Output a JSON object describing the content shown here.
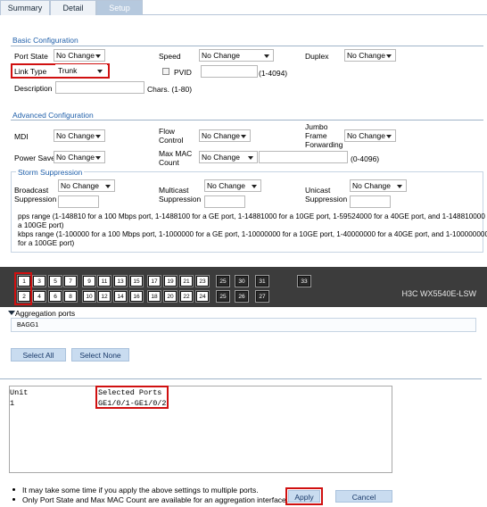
{
  "tabs": [
    "Summary",
    "Detail",
    "Setup"
  ],
  "basic": {
    "title": "Basic Configuration",
    "port_state_label": "Port State",
    "port_state_value": "No Change",
    "speed_label": "Speed",
    "speed_value": "No Change",
    "duplex_label": "Duplex",
    "duplex_value": "No Change",
    "link_type_label": "Link Type",
    "link_type_value": "Trunk",
    "pvid_label": "PVID",
    "pvid_hint": "(1-4094)",
    "description_label": "Description",
    "description_hint": "Chars. (1-80)"
  },
  "advanced": {
    "title": "Advanced Configuration",
    "mdi_label": "MDI",
    "mdi_value": "No Change",
    "flow_label_1": "Flow",
    "flow_label_2": "Control",
    "flow_value": "No Change",
    "jumbo_label_1": "Jumbo",
    "jumbo_label_2": "Frame",
    "jumbo_label_3": "Forwarding",
    "jumbo_value": "No Change",
    "power_label": "Power Save",
    "power_value": "No Change",
    "maxmac_label_1": "Max MAC",
    "maxmac_label_2": "Count",
    "maxmac_value": "No Change",
    "maxmac_hint": "(0-4096)"
  },
  "storm": {
    "title": "Storm Suppression",
    "broadcast_1": "Broadcast",
    "broadcast_2": "Suppression",
    "broadcast_value": "No Change",
    "multicast_1": "Multicast",
    "multicast_2": "Suppression",
    "multicast_value": "No Change",
    "unicast_1": "Unicast",
    "unicast_2": "Suppression",
    "unicast_value": "No Change",
    "pps_1": "pps range (1-148810 for a 100 Mbps port, 1-1488100 for a GE port, 1-14881000 for a 10GE port, 1-59524000 for a 40GE port, and 1-148810000 for",
    "pps_2": "a 100GE port)",
    "kbps_1": "kbps range (1-100000 for a 100 Mbps port, 1-1000000 for a GE port, 1-10000000 for a 10GE port, 1-40000000 for a 40GE port, and 1-100000000",
    "kbps_2": "for a 100GE port)"
  },
  "panel": {
    "device": "H3C WX5540E-LSW",
    "top_ports": [
      "1",
      "3",
      "5",
      "7",
      "9",
      "11",
      "13",
      "15",
      "17",
      "19",
      "21",
      "23",
      "25",
      "30",
      "31",
      "33"
    ],
    "bottom_ports": [
      "2",
      "4",
      "6",
      "8",
      "10",
      "12",
      "14",
      "16",
      "18",
      "20",
      "22",
      "24",
      "25",
      "26",
      "27",
      "28"
    ]
  },
  "aggregation": {
    "label": "Aggregation ports",
    "item": "BAGG1"
  },
  "buttons": {
    "select_all": "Select All",
    "select_none": "Select None",
    "apply": "Apply",
    "cancel": "Cancel"
  },
  "selected": {
    "unit_header": "Unit",
    "ports_header": "Selected Ports",
    "unit": "1",
    "ports": "GE1/0/1-GE1/0/2"
  },
  "notes": [
    "It may take some time if you apply the above settings to multiple ports.",
    "Only Port State and Max MAC Count are available for an aggregation interface."
  ]
}
